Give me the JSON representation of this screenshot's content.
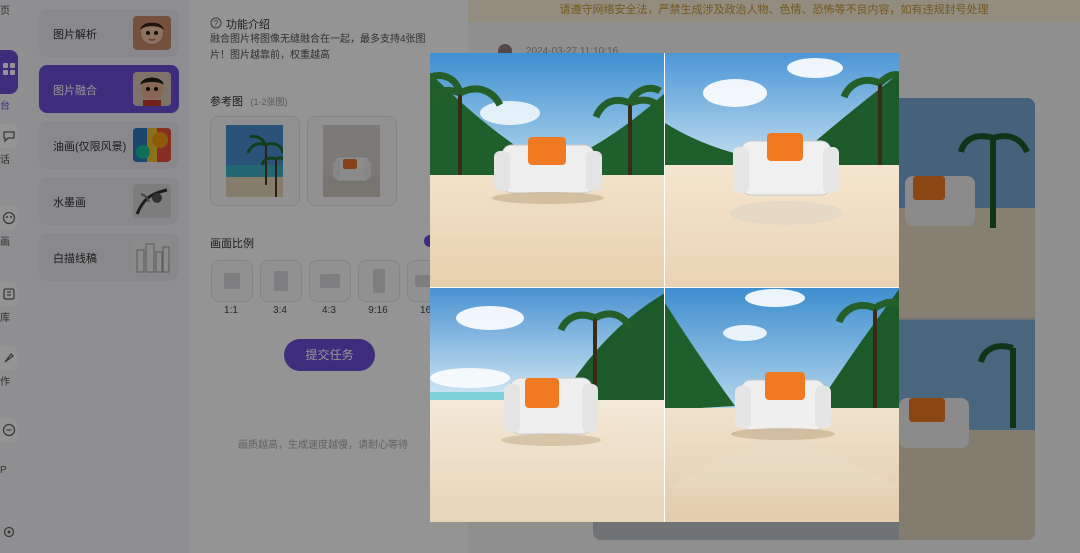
{
  "rail": {
    "items": [
      {
        "label": "页",
        "icon": "home-icon",
        "active": false
      },
      {
        "label": "台",
        "icon": "grid-icon",
        "active": true
      },
      {
        "label": "话",
        "icon": "chat-icon",
        "active": false
      },
      {
        "label": "画",
        "icon": "palette-icon",
        "active": false
      },
      {
        "label": "库",
        "icon": "library-icon",
        "active": false
      },
      {
        "label": "作",
        "icon": "brush-icon",
        "active": false
      },
      {
        "label": "P",
        "icon": "app-icon",
        "active": false
      }
    ]
  },
  "features": [
    {
      "name": "图片解析",
      "active": false
    },
    {
      "name": "图片融合",
      "active": true
    },
    {
      "name": "油画(仅限风景)",
      "active": false
    },
    {
      "name": "水墨画",
      "active": false
    },
    {
      "name": "白描线稿",
      "active": false
    }
  ],
  "settings": {
    "intro_title": "功能介绍",
    "intro_desc_line1": "融合图片将图像无缝融合在一起，最多支持4张图",
    "intro_desc_line2": "片！图片越靠前，权重越高",
    "ref_title": "参考图",
    "ref_hint": "(1-2张图)",
    "ratio_title": "画面比例",
    "ratios": [
      "1:1",
      "3:4",
      "4:3",
      "9:16",
      "16:"
    ],
    "submit_label": "提交任务",
    "footer_hint": "画质越高，生成速度越慢，请耐心等待"
  },
  "main": {
    "notice": "请遵守网络安全法，严禁生成涉及政治人物、色情、恐怖等不良内容，如有违规封号处理",
    "timestamp": "2024-03-27 11:10:16"
  },
  "colors": {
    "accent": "#6b4fd8",
    "notice_bg": "#fbf3da",
    "notice_text": "#c79a3a"
  }
}
